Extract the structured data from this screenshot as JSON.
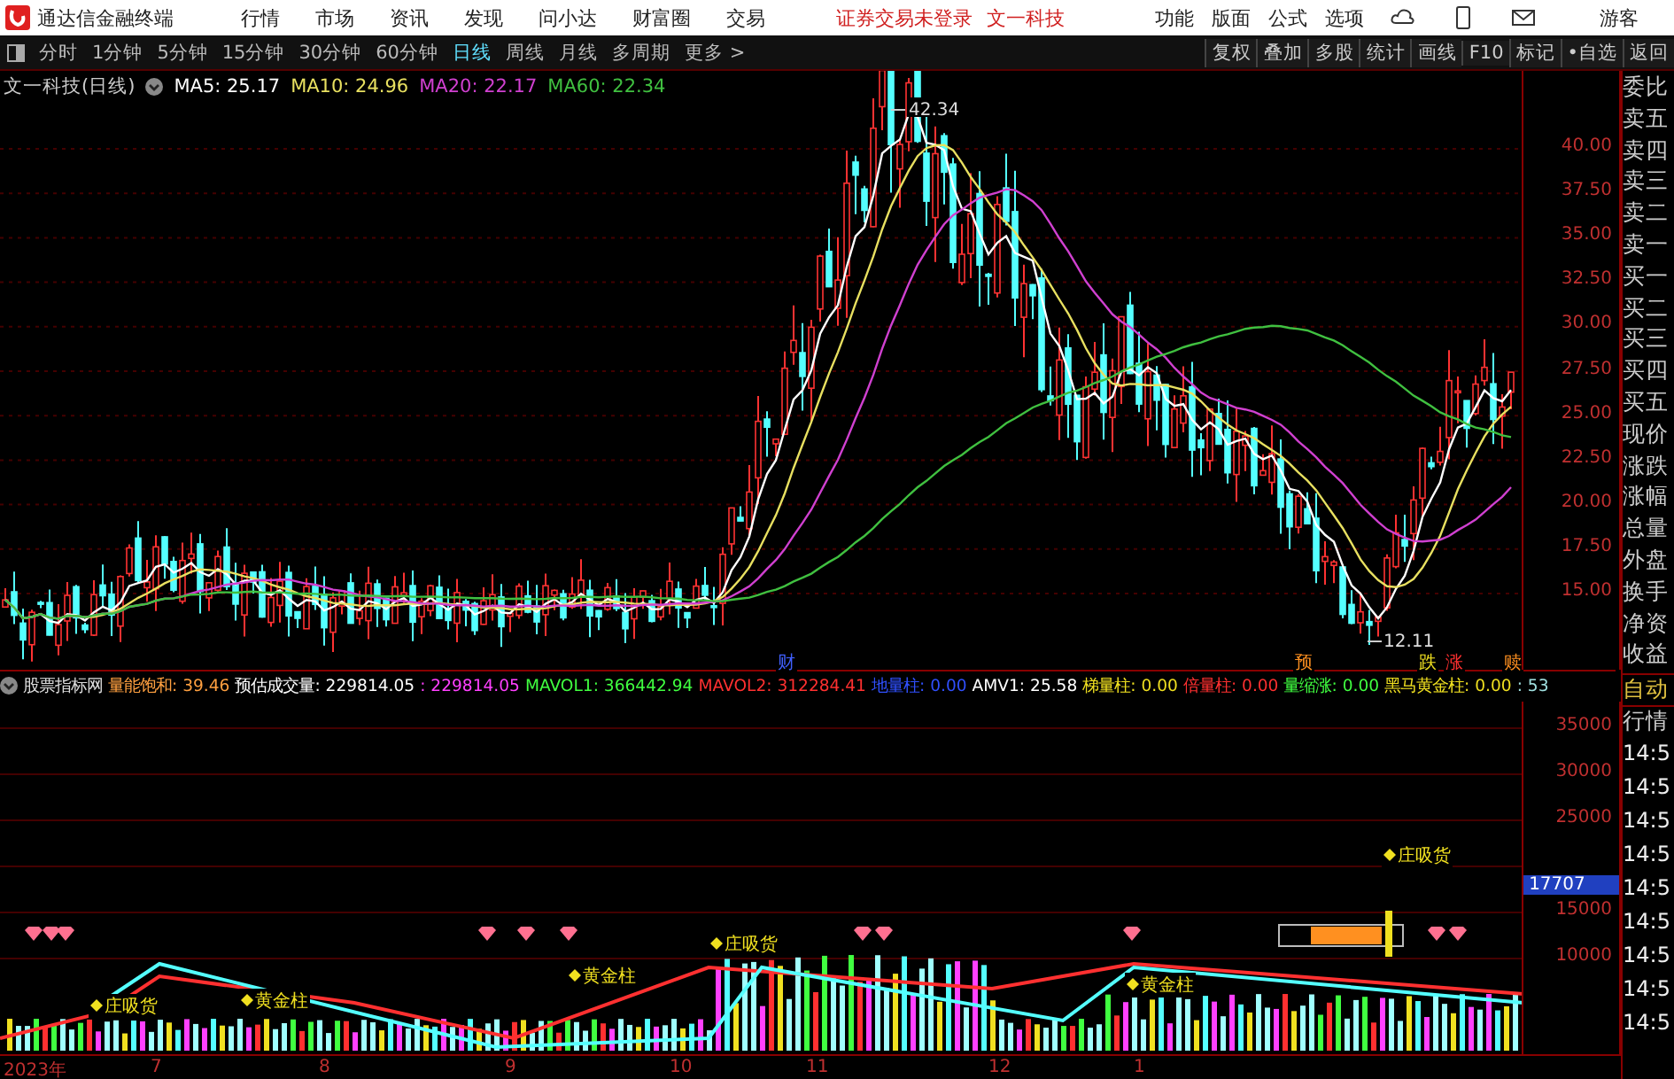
{
  "window": {
    "title": "通达信金融终端"
  },
  "menu": [
    "行情",
    "市场",
    "资讯",
    "发现",
    "问小达",
    "财富圈",
    "交易"
  ],
  "status": {
    "login": "证券交易未登录",
    "stock": "文一科技"
  },
  "top_actions": [
    "功能",
    "版面",
    "公式",
    "选项"
  ],
  "user": "游客",
  "periods": [
    {
      "label": "分时",
      "selected": false
    },
    {
      "label": "1分钟",
      "selected": false
    },
    {
      "label": "5分钟",
      "selected": false
    },
    {
      "label": "15分钟",
      "selected": false
    },
    {
      "label": "30分钟",
      "selected": false
    },
    {
      "label": "60分钟",
      "selected": false
    },
    {
      "label": "日线",
      "selected": true
    },
    {
      "label": "周线",
      "selected": false
    },
    {
      "label": "月线",
      "selected": false
    },
    {
      "label": "多周期",
      "selected": false
    },
    {
      "label": "更多 >",
      "selected": false
    }
  ],
  "tools": [
    "复权",
    "叠加",
    "多股",
    "统计",
    "画线",
    "F10",
    "标记",
    "•自选",
    "返回"
  ],
  "main_chart": {
    "title": "文一科技(日线)",
    "ma": [
      {
        "label": "MA5: 25.17",
        "color": "#ffffff"
      },
      {
        "label": "MA10: 24.96",
        "color": "#e8e060"
      },
      {
        "label": "MA20: 22.17",
        "color": "#d040d0"
      },
      {
        "label": "MA60: 22.34",
        "color": "#40c040"
      }
    ],
    "high_label": "42.34",
    "low_label": "12.11",
    "markers": [
      {
        "text": "财",
        "color": "#4060ff"
      },
      {
        "text": "预",
        "color": "#ff9020"
      },
      {
        "text": "跌",
        "color": "#f0e020"
      },
      {
        "text": "涨",
        "color": "#ff3030"
      },
      {
        "text": "赎",
        "color": "#ff9020"
      }
    ],
    "yticks": [
      "40.00",
      "37.50",
      "35.00",
      "32.50",
      "30.00",
      "27.50",
      "25.00",
      "22.50",
      "20.00",
      "17.50",
      "15.00"
    ]
  },
  "quote_panel": [
    "委比",
    "卖五",
    "卖四",
    "卖三",
    "卖二",
    "卖一",
    "买一",
    "买二",
    "买三",
    "买四",
    "买五",
    "现价",
    "涨跌",
    "涨幅",
    "总量",
    "外盘",
    "换手",
    "净资",
    "收益"
  ],
  "indicator": {
    "title": "股票指标网",
    "items": [
      {
        "text": "量能饱和: 39.46",
        "color": "#ffa040"
      },
      {
        "text": "预估成交量: 229814.05",
        "color": "#ffffff"
      },
      {
        "text": ": 229814.05",
        "color": "#ff40ff"
      },
      {
        "text": "MAVOL1: 366442.94",
        "color": "#40ff40"
      },
      {
        "text": "MAVOL2: 312284.41",
        "color": "#ff3030"
      },
      {
        "text": "地量柱: 0.00",
        "color": "#3050ff"
      },
      {
        "text": "AMV1: 25.58",
        "color": "#ffffff"
      },
      {
        "text": "梯量柱: 0.00",
        "color": "#f0e020"
      },
      {
        "text": "倍量柱: 0.00",
        "color": "#ff3030"
      },
      {
        "text": "量缩涨: 0.00",
        "color": "#40ff40"
      },
      {
        "text": "黑马黄金柱: 0.00",
        "color": "#f0e020"
      },
      {
        "text": ": 53",
        "color": "#a0e0e0"
      }
    ],
    "yticks": [
      "35000",
      "30000",
      "25000",
      "15000",
      "10000"
    ],
    "current": "17707",
    "signals": [
      "庄吸货",
      "庄吸货",
      "黄金柱",
      "黄金柱",
      "庄吸货",
      "黄金柱"
    ]
  },
  "side_bottom": {
    "mode": "自动",
    "tab": "行情",
    "times": [
      "14:5",
      "14:5",
      "14:5",
      "14:5",
      "14:5",
      "14:5",
      "14:5",
      "14:5",
      "14:5"
    ]
  },
  "xaxis": [
    "2023年",
    "7",
    "8",
    "9",
    "10",
    "11",
    "12",
    "1"
  ]
}
